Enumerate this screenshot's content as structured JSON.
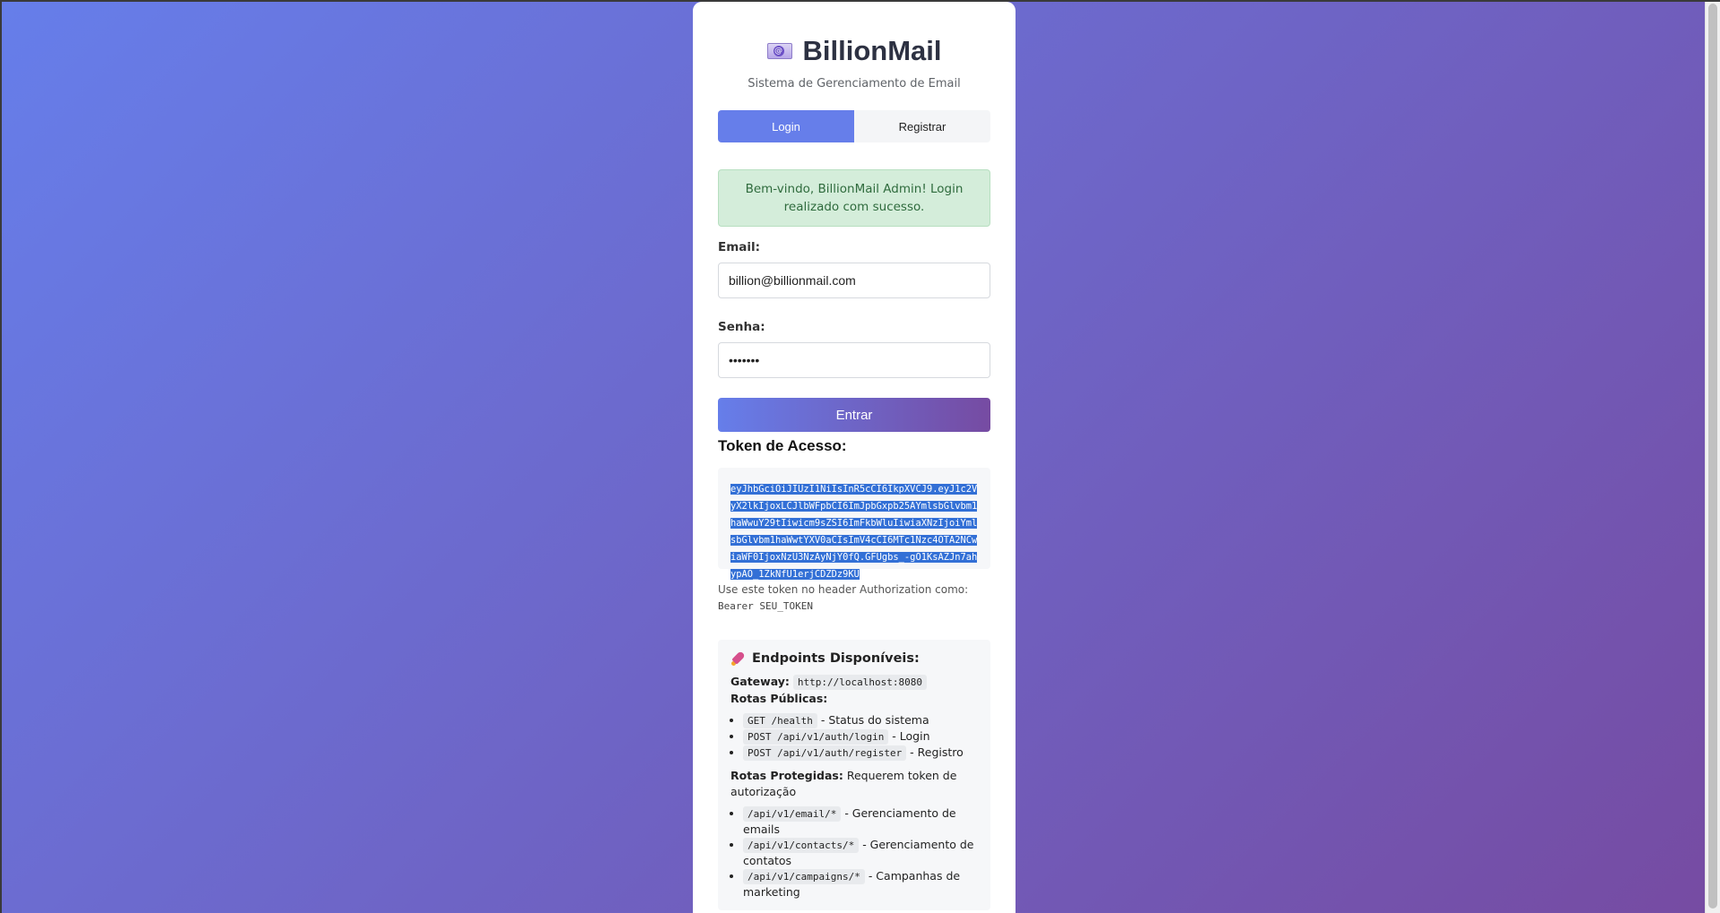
{
  "app": {
    "title": "BillionMail",
    "subtitle": "Sistema de Gerenciamento de Email"
  },
  "tabs": [
    {
      "label": "Login",
      "active": true
    },
    {
      "label": "Registrar",
      "active": false
    }
  ],
  "alert": {
    "message": "Bem-vindo, BillionMail Admin! Login realizado com sucesso."
  },
  "form": {
    "email_label": "Email:",
    "email_value": "billion@billionmail.com",
    "password_label": "Senha:",
    "password_value": "•••••••",
    "submit_label": "Entrar"
  },
  "token": {
    "title": "Token de Acesso:",
    "value": "eyJhbGciOiJIUzI1NiIsInR5cCI6IkpXVCJ9.eyJ1c2VyX2lkIjoxLCJlbWFpbCI6ImJpbGxpb25AYmlsbGlvbm1haWwuY29tIiwicm9sZSI6ImFkbWluIiwiaXNzIjoiYmlsbGlvbm1haWwtYXV0aCIsImV4cCI6MTc1Nzc4OTA2NCwiaWF0IjoxNzU3NzAyNjY0fQ.GFUgbs_-gO1KsAZJn7ahypAO_1ZkNfU1erjCDZDz9KU",
    "hint_text": "Use este token no header Authorization como:",
    "hint_code": "Bearer SEU_TOKEN"
  },
  "endpoints": {
    "title": "Endpoints Disponíveis:",
    "gateway_label": "Gateway:",
    "gateway_value": "http://localhost:8080",
    "public_label": "Rotas Públicas:",
    "public_routes": [
      {
        "path": "GET /health",
        "desc": " - Status do sistema"
      },
      {
        "path": "POST /api/v1/auth/login",
        "desc": " - Login"
      },
      {
        "path": "POST /api/v1/auth/register",
        "desc": " - Registro"
      }
    ],
    "protected_label": "Rotas Protegidas:",
    "protected_desc": " Requerem token de autorização",
    "protected_routes": [
      {
        "path": "/api/v1/email/*",
        "desc": " - Gerenciamento de emails"
      },
      {
        "path": "/api/v1/contacts/*",
        "desc": " - Gerenciamento de contatos"
      },
      {
        "path": "/api/v1/campaigns/*",
        "desc": " - Campanhas de marketing"
      }
    ]
  }
}
